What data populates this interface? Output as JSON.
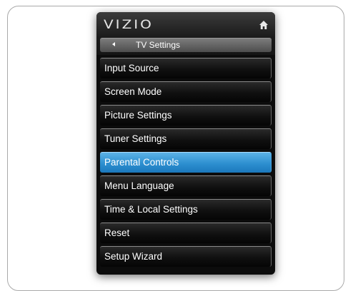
{
  "menu": {
    "brand": "VIZIO",
    "breadcrumb": "TV Settings",
    "items": [
      {
        "label": "Input Source"
      },
      {
        "label": "Screen Mode"
      },
      {
        "label": "Picture Settings"
      },
      {
        "label": "Tuner Settings"
      },
      {
        "label": "Parental Controls",
        "selected": true
      },
      {
        "label": "Menu Language"
      },
      {
        "label": "Time & Local Settings"
      },
      {
        "label": "Reset"
      },
      {
        "label": "Setup Wizard"
      }
    ],
    "selected_color": "#2d8fd0"
  },
  "icons": {
    "home": "home-icon",
    "back": "back-arrow-icon"
  }
}
